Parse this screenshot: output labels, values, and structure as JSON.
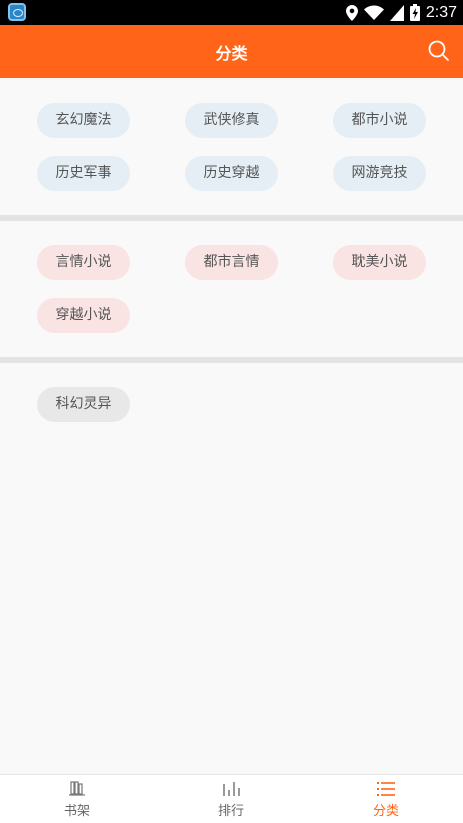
{
  "status_bar": {
    "time": "2:37"
  },
  "app_bar": {
    "title": "分类"
  },
  "groups": [
    {
      "tags": [
        "玄幻魔法",
        "武侠修真",
        "都市小说",
        "历史军事",
        "历史穿越",
        "网游竞技"
      ]
    },
    {
      "tags": [
        "言情小说",
        "都市言情",
        "耽美小说",
        "穿越小说"
      ]
    },
    {
      "tags": [
        "科幻灵异"
      ]
    }
  ],
  "bottom_nav": {
    "items": [
      {
        "label": "书架",
        "icon": "bookshelf-icon"
      },
      {
        "label": "排行",
        "icon": "ranking-icon"
      },
      {
        "label": "分类",
        "icon": "category-list-icon"
      }
    ]
  },
  "colors": {
    "accent": "#ff6419",
    "tag_blue": "#e4eef4",
    "tag_pink": "#f9e3e3",
    "tag_gray": "#e8e8e8"
  }
}
